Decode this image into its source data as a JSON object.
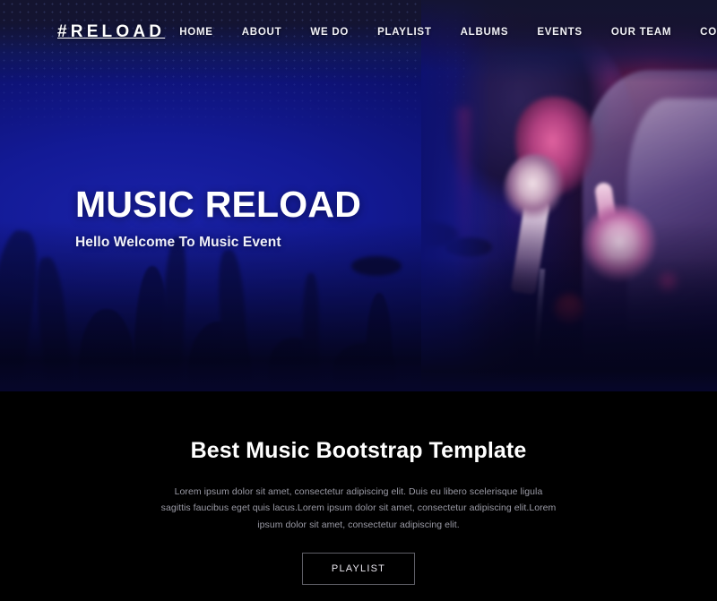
{
  "site": {
    "logo": "#RELOAD"
  },
  "nav": {
    "items": [
      {
        "label": "HOME"
      },
      {
        "label": "ABOUT"
      },
      {
        "label": "WE DO"
      },
      {
        "label": "PLAYLIST"
      },
      {
        "label": "ALBUMS"
      },
      {
        "label": "EVENTS"
      },
      {
        "label": "OUR TEAM"
      },
      {
        "label": "CONTACT"
      }
    ]
  },
  "hero": {
    "title": "MUSIC RELOAD",
    "subtitle": "Hello Welcome To Music Event",
    "image_alt": "singer holding microphone on stage with pink and blue concert lighting"
  },
  "about": {
    "title": "Best Music Bootstrap Template",
    "paragraph": "Lorem ipsum dolor sit amet, consectetur adipiscing elit. Duis eu libero scelerisque ligula sagittis faucibus eget quis lacus.Lorem ipsum dolor sit amet, consectetur adipiscing elit.Lorem ipsum dolor sit amet, consectetur adipiscing elit.",
    "button_label": "PLAYLIST"
  },
  "colors": {
    "hero_blue": "#131a96",
    "hero_dark_navy": "#14142f",
    "section_black": "#000000",
    "text_white": "#ffffff",
    "body_gray": "#9a9aa5",
    "button_border": "#5e5e66",
    "accent_magenta": "#cf2a3c"
  }
}
